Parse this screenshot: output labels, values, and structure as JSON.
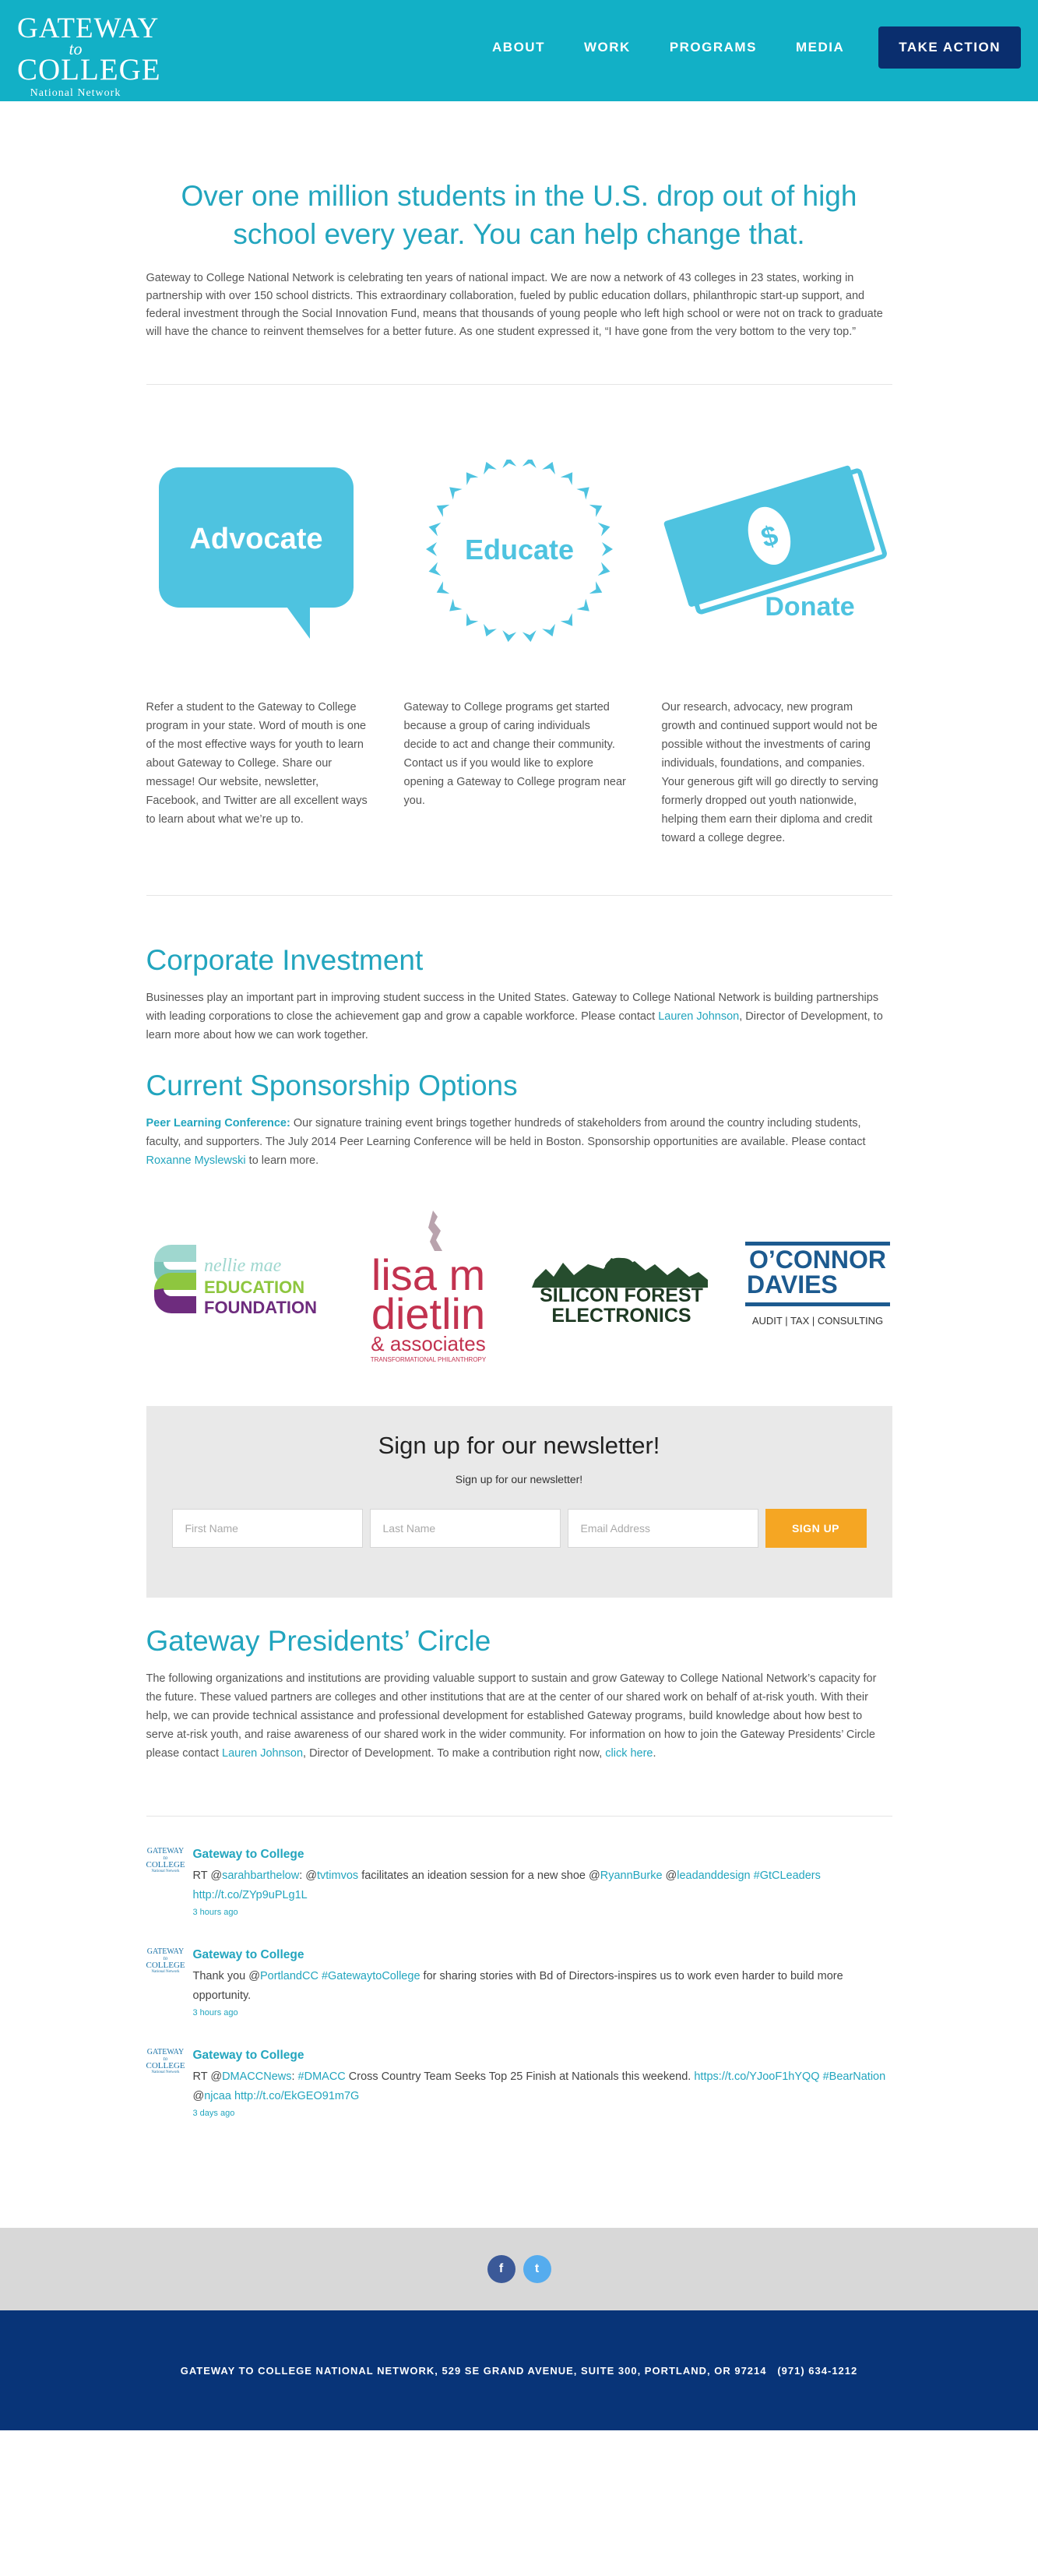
{
  "header": {
    "logo": {
      "line1": "GATEWAY",
      "line2": "to",
      "line3": "COLLEGE",
      "line4": "National Network"
    },
    "nav": [
      "ABOUT",
      "WORK",
      "PROGRAMS",
      "MEDIA"
    ],
    "cta": "TAKE ACTION"
  },
  "intro": {
    "title": "Over one million students in the U.S. drop out of high school every year. You can help change that.",
    "text": "Gateway to College National Network is celebrating ten years of national impact. We are now a network of 43 colleges in 23 states, working in partnership with over 150 school districts. This extraordinary collaboration, fueled by public education dollars, philanthropic start-up support, and federal investment through the Social Innovation Fund, means that thousands of young people who left high school or were not on track to graduate will have the chance to reinvent themselves for a better future. As one student expressed it, “I have gone from the very bottom to the very top.”"
  },
  "pillars": [
    {
      "label": "Advocate",
      "text": "Refer a student to the Gateway to College program in your state. Word of mouth is one of the most effective ways for youth to learn about Gateway to College. Share our message! Our website, newsletter, Facebook, and Twitter are all excellent ways to learn about what we’re up to."
    },
    {
      "label": "Educate",
      "text": "Gateway to College programs get started because a group of caring individuals decide to act and change their community. Contact us if you would like to explore opening a Gateway to College program near you."
    },
    {
      "label": "Donate",
      "symbol": "$",
      "text": "Our research, advocacy, new program growth and continued support would not be possible without the investments of caring individuals, foundations, and companies. Your generous gift will go directly to serving formerly dropped out youth nationwide, helping them earn their diploma and credit toward a college degree."
    }
  ],
  "corporate": {
    "title": "Corporate Investment",
    "text_before": "Businesses play an important part in improving student success in the United States. Gateway to College National Network is building partnerships with leading corporations to close the achievement gap and grow a capable workforce. Please contact ",
    "link": "Lauren Johnson",
    "text_after": ", Director of Development, to learn more about how we can work together."
  },
  "sponsorship": {
    "title": "Current Sponsorship Options",
    "lead": "Peer Learning Conference:",
    "text_before": " Our signature training event brings together hundreds of stakeholders from around the country including students, faculty, and supporters. The July 2014 Peer Learning Conference will be held in Boston. Sponsorship opportunities are available. Please contact ",
    "link": "Roxanne Myslewski",
    "text_after": " to learn more."
  },
  "sponsors": {
    "nellie": {
      "line1": "nellie mae",
      "line2": "EDUCATION",
      "line3": "FOUNDATION"
    },
    "lisa": {
      "line1": "lisa m",
      "line2": "dietlin",
      "line3": "& associates",
      "line4": "TRANSFORMATIONAL PHILANTHROPY"
    },
    "silicon": {
      "line1": "SILICON FOREST",
      "line2": "ELECTRONICS"
    },
    "oconnor": {
      "line1": "O’CONNOR",
      "line2": "DAVIES",
      "line3": "AUDIT | TAX | CONSULTING"
    }
  },
  "newsletter": {
    "title": "Sign up for our newsletter!",
    "subtitle": "Sign up for our newsletter!",
    "first_name_placeholder": "First Name",
    "last_name_placeholder": "Last Name",
    "email_placeholder": "Email Address",
    "button": "SIGN UP"
  },
  "presidents": {
    "title": "Gateway Presidents’ Circle",
    "text_before": "The following organizations and institutions are providing valuable support to sustain and grow Gateway to College National Network’s capacity for the future. These valued partners are colleges and other institutions that are at the center of our shared work on behalf of at-risk youth. With their help, we can provide technical assistance and professional development for established Gateway programs, build knowledge about how best to serve at-risk youth, and raise awareness of our shared work in the wider community. For information on how to join the Gateway Presidents’ Circle please contact ",
    "link1": "Lauren Johnson",
    "text_middle": ", Director of Development. To make a contribution right now, ",
    "link2": "click here",
    "text_after": "."
  },
  "tweets": [
    {
      "author": "Gateway to College",
      "parts": [
        {
          "t": "RT @",
          "link": false
        },
        {
          "t": "sarahbarthelow",
          "link": true
        },
        {
          "t": ": @",
          "link": false
        },
        {
          "t": "tvtimvos",
          "link": true
        },
        {
          "t": " facilitates an ideation session for a new shoe @",
          "link": false
        },
        {
          "t": "RyannBurke",
          "link": true
        },
        {
          "t": " @",
          "link": false
        },
        {
          "t": "leadanddesign",
          "link": true
        },
        {
          "t": " ",
          "link": false
        },
        {
          "t": "#GtCLeaders",
          "link": true
        },
        {
          "t": " ",
          "link": false
        },
        {
          "t": "http://t.co/ZYp9uPLg1L",
          "link": true
        }
      ],
      "time": "3 hours ago"
    },
    {
      "author": "Gateway to College",
      "parts": [
        {
          "t": "Thank you @",
          "link": false
        },
        {
          "t": "PortlandCC",
          "link": true
        },
        {
          "t": " ",
          "link": false
        },
        {
          "t": "#GatewaytoCollege",
          "link": true
        },
        {
          "t": " for sharing stories with Bd of Directors-inspires us to work even harder to build more opportunity.",
          "link": false
        }
      ],
      "time": "3 hours ago"
    },
    {
      "author": "Gateway to College",
      "parts": [
        {
          "t": "RT @",
          "link": false
        },
        {
          "t": "DMACCNews",
          "link": true
        },
        {
          "t": ": ",
          "link": false
        },
        {
          "t": "#DMACC",
          "link": true
        },
        {
          "t": " Cross Country Team Seeks Top 25 Finish at Nationals this weekend. ",
          "link": false
        },
        {
          "t": "https://t.co/YJooF1hYQQ",
          "link": true
        },
        {
          "t": " ",
          "link": false
        },
        {
          "t": "#BearNation",
          "link": true
        },
        {
          "t": " @",
          "link": false
        },
        {
          "t": "njcaa",
          "link": true
        },
        {
          "t": " ",
          "link": false
        },
        {
          "t": "http://t.co/EkGEO91m7G",
          "link": true
        }
      ],
      "time": "3 days ago"
    }
  ],
  "social": {
    "facebook": "f",
    "twitter": "t"
  },
  "footer": {
    "address": "GATEWAY TO COLLEGE NATIONAL NETWORK, 529 SE GRAND AVENUE, SUITE 300, PORTLAND, OR 97214   (971) 634-1212"
  },
  "colors": {
    "brand_teal": "#12b0c6",
    "heading_teal": "#22a5be",
    "navy": "#0a2e6e",
    "footer_navy": "#083478",
    "signup_orange": "#f5a623",
    "icon_blue": "#4ec3e0"
  }
}
